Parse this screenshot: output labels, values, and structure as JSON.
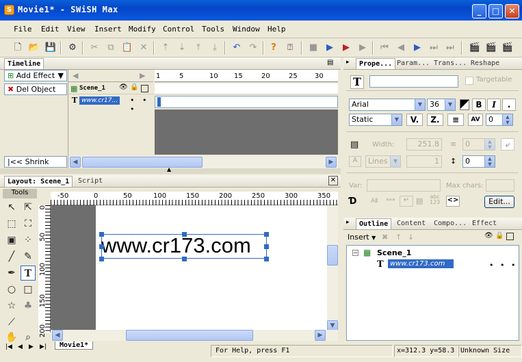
{
  "window": {
    "title": "Movie1* - SWiSH Max",
    "controls": [
      "_",
      "□",
      "✕"
    ]
  },
  "menu": [
    "File",
    "Edit",
    "View",
    "Insert",
    "Modify",
    "Control",
    "Tools",
    "Window",
    "Help"
  ],
  "timeline": {
    "tab": "Timeline",
    "add_effect": "Add Effect",
    "del_object": "Del Object",
    "shrink": "Shrink",
    "scene_row": "Scene_1",
    "text_row": "www.cr17...",
    "frame_ticks": [
      "1",
      "5",
      "10",
      "15",
      "20",
      "25",
      "30"
    ]
  },
  "layout": {
    "tabs": [
      "Layout: Scene_1",
      "Script"
    ],
    "tools_label": "Tools",
    "ruler_h": [
      "-50",
      "0",
      "50",
      "100",
      "150",
      "200",
      "250",
      "300",
      "350"
    ],
    "ruler_v": [
      "0",
      "50",
      "100",
      "150",
      "200"
    ],
    "stage_text": "www.cr173.com",
    "scene_tab": "Movie1*"
  },
  "properties": {
    "tabs": [
      "Prope...",
      "Param...",
      "Trans...",
      "Reshape"
    ],
    "targetable": "Targetable",
    "font": "Arial",
    "size": "36",
    "text_type": "Static",
    "spacing": "0",
    "width_label": "Width:",
    "width_value": "251.8",
    "indent_value": "0",
    "lines": "Lines",
    "lines_value": "1",
    "line_spacing": "0",
    "var_label": "Var:",
    "max_chars": "Max chars:",
    "edit": "Edit...",
    "abc": "abc",
    "num": "123"
  },
  "outline": {
    "tabs": [
      "Outline",
      "Content",
      "Compo...",
      "Effect"
    ],
    "insert": "Insert",
    "scene": "Scene_1",
    "item": "www.cr173.com",
    "dots": "• • •"
  },
  "status": {
    "help": "For Help, press F1",
    "coords": "x=312.3 y=58.3",
    "size": "Unknown Size"
  }
}
